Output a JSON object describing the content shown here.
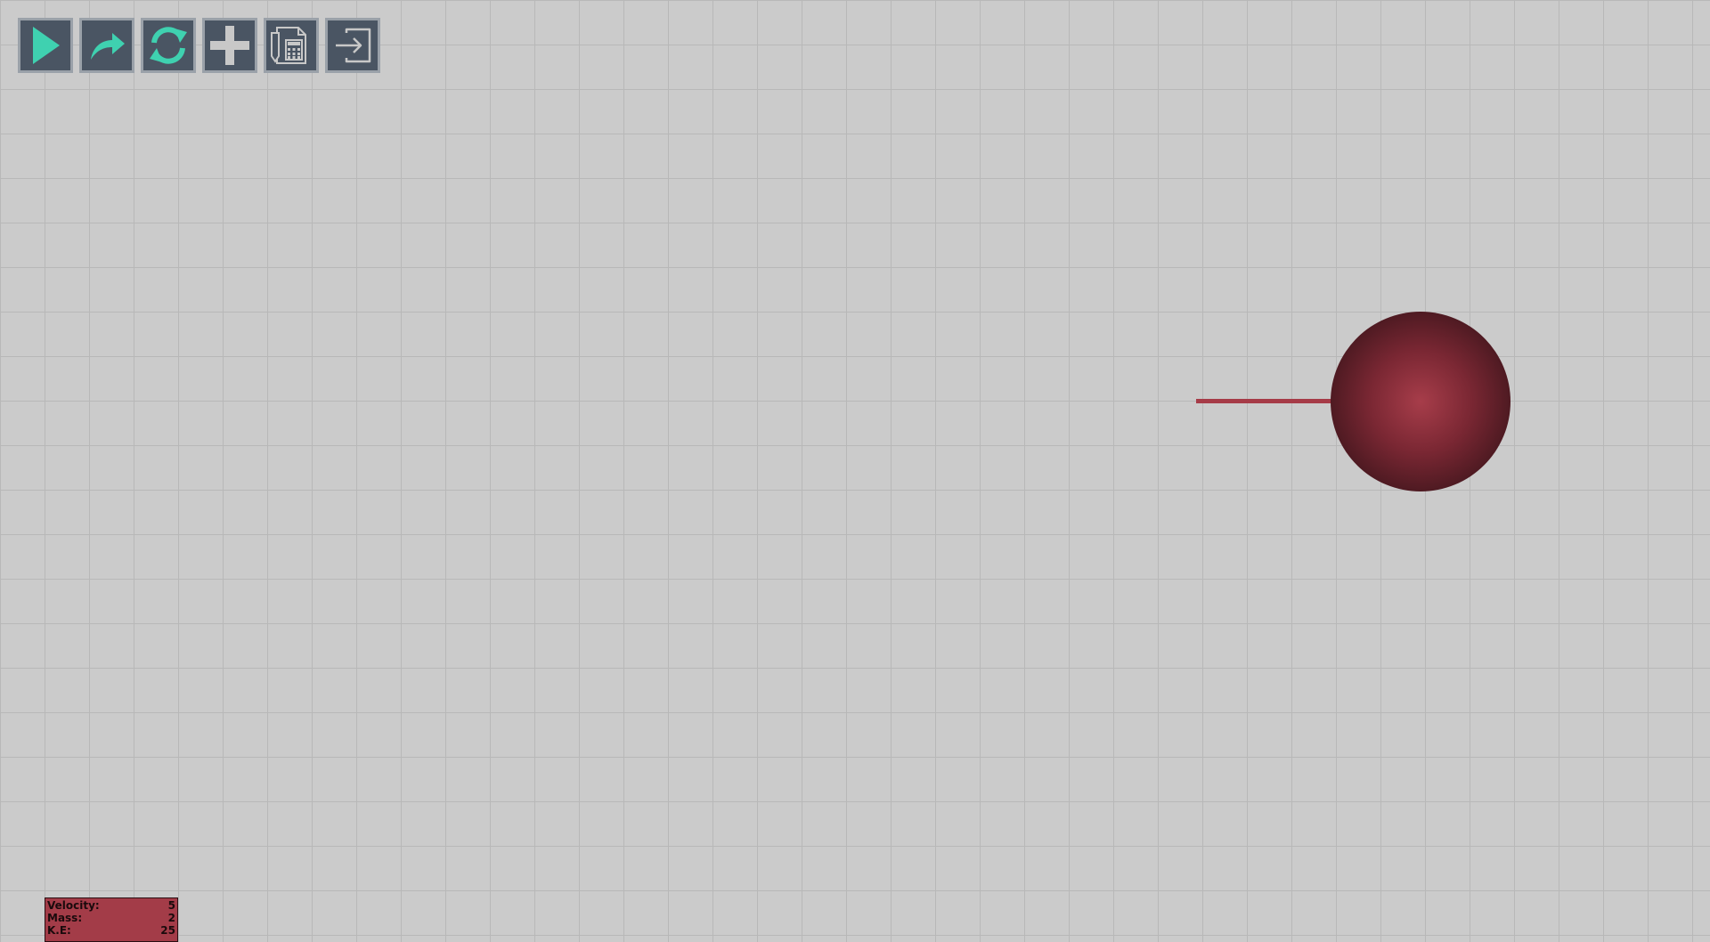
{
  "toolbar": {
    "buttons": [
      {
        "name": "play",
        "icon": "play-icon",
        "color": "#3fd1b0"
      },
      {
        "name": "step",
        "icon": "redo-arrow-icon",
        "color": "#3fd1b0"
      },
      {
        "name": "reset",
        "icon": "refresh-icon",
        "color": "#3fd1b0"
      },
      {
        "name": "add",
        "icon": "plus-icon",
        "color": "#c8c8c8"
      },
      {
        "name": "calculator",
        "icon": "document-calculator-icon",
        "color": "#c8c8c8"
      },
      {
        "name": "exit",
        "icon": "sign-in-icon",
        "color": "#c8c8c8"
      }
    ]
  },
  "simulation": {
    "ball_color": "#a73d4a",
    "vector_color": "#a63b47",
    "grid_color": "#b8b8b8",
    "background_color": "#cbcbcb"
  },
  "info": {
    "velocity_label": "Velocity:",
    "velocity_value": "5",
    "mass_label": "Mass:",
    "mass_value": "2",
    "ke_label": "K.E:",
    "ke_value": "25"
  }
}
